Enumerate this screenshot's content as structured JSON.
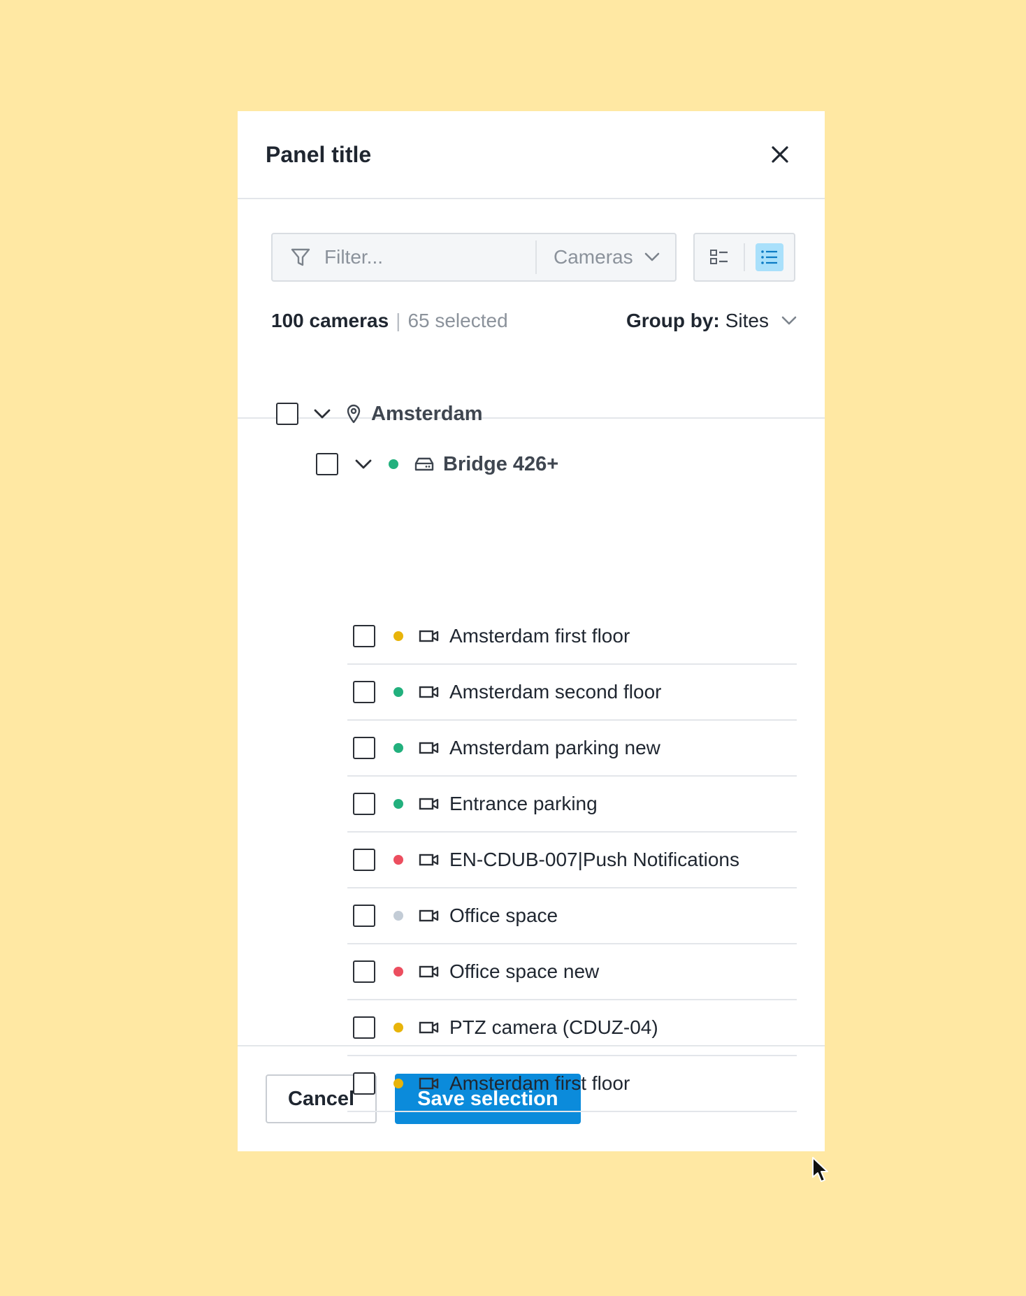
{
  "panel": {
    "title": "Panel title",
    "close_icon": "close-icon"
  },
  "filter": {
    "placeholder": "Filter...",
    "icon": "filter-icon",
    "type_select": "Cameras"
  },
  "view_toggle": {
    "options": [
      "grouped-list-icon",
      "list-icon"
    ],
    "active": "list-icon",
    "active_color": "#A9E0FB"
  },
  "summary": {
    "count": "100 cameras",
    "separator": "|",
    "selected": "65 selected",
    "group_by_label": "Group by:",
    "group_by_value": "Sites"
  },
  "tree": {
    "site": {
      "name": "Amsterdam",
      "icon": "location-pin-icon",
      "checked": false,
      "expanded": true
    },
    "device": {
      "name": "Bridge 426+",
      "icon": "bridge-device-icon",
      "status_color": "#22B07D",
      "checked": false,
      "expanded": true
    },
    "cameras": [
      {
        "name": "Amsterdam first floor",
        "status_color": "#E8B40A",
        "checked": false
      },
      {
        "name": "Amsterdam second floor",
        "status_color": "#22B07D",
        "checked": false
      },
      {
        "name": "Amsterdam parking new",
        "status_color": "#22B07D",
        "checked": false
      },
      {
        "name": "Entrance parking",
        "status_color": "#22B07D",
        "checked": false
      },
      {
        "name": "EN-CDUB-007|Push Notifications",
        "status_color": "#EC4E5F",
        "checked": false
      },
      {
        "name": "Office space",
        "status_color": "#C3CCD6",
        "checked": false
      },
      {
        "name": "Office space new",
        "status_color": "#EC4E5F",
        "checked": false
      },
      {
        "name": "PTZ camera (CDUZ-04)",
        "status_color": "#E8B40A",
        "checked": false
      },
      {
        "name": "Amsterdam first floor",
        "status_color": "#E8B40A",
        "checked": false
      }
    ],
    "camera_icon": "video-camera-icon"
  },
  "footer": {
    "cancel_label": "Cancel",
    "save_label": "Save selection",
    "save_color": "#0B8BDB"
  },
  "colors": {
    "background": "#FFE8A3",
    "panel": "#FFFFFF",
    "status_online": "#22B07D",
    "status_warning": "#E8B40A",
    "status_offline": "#EC4E5F",
    "status_unknown": "#C3CCD6"
  }
}
